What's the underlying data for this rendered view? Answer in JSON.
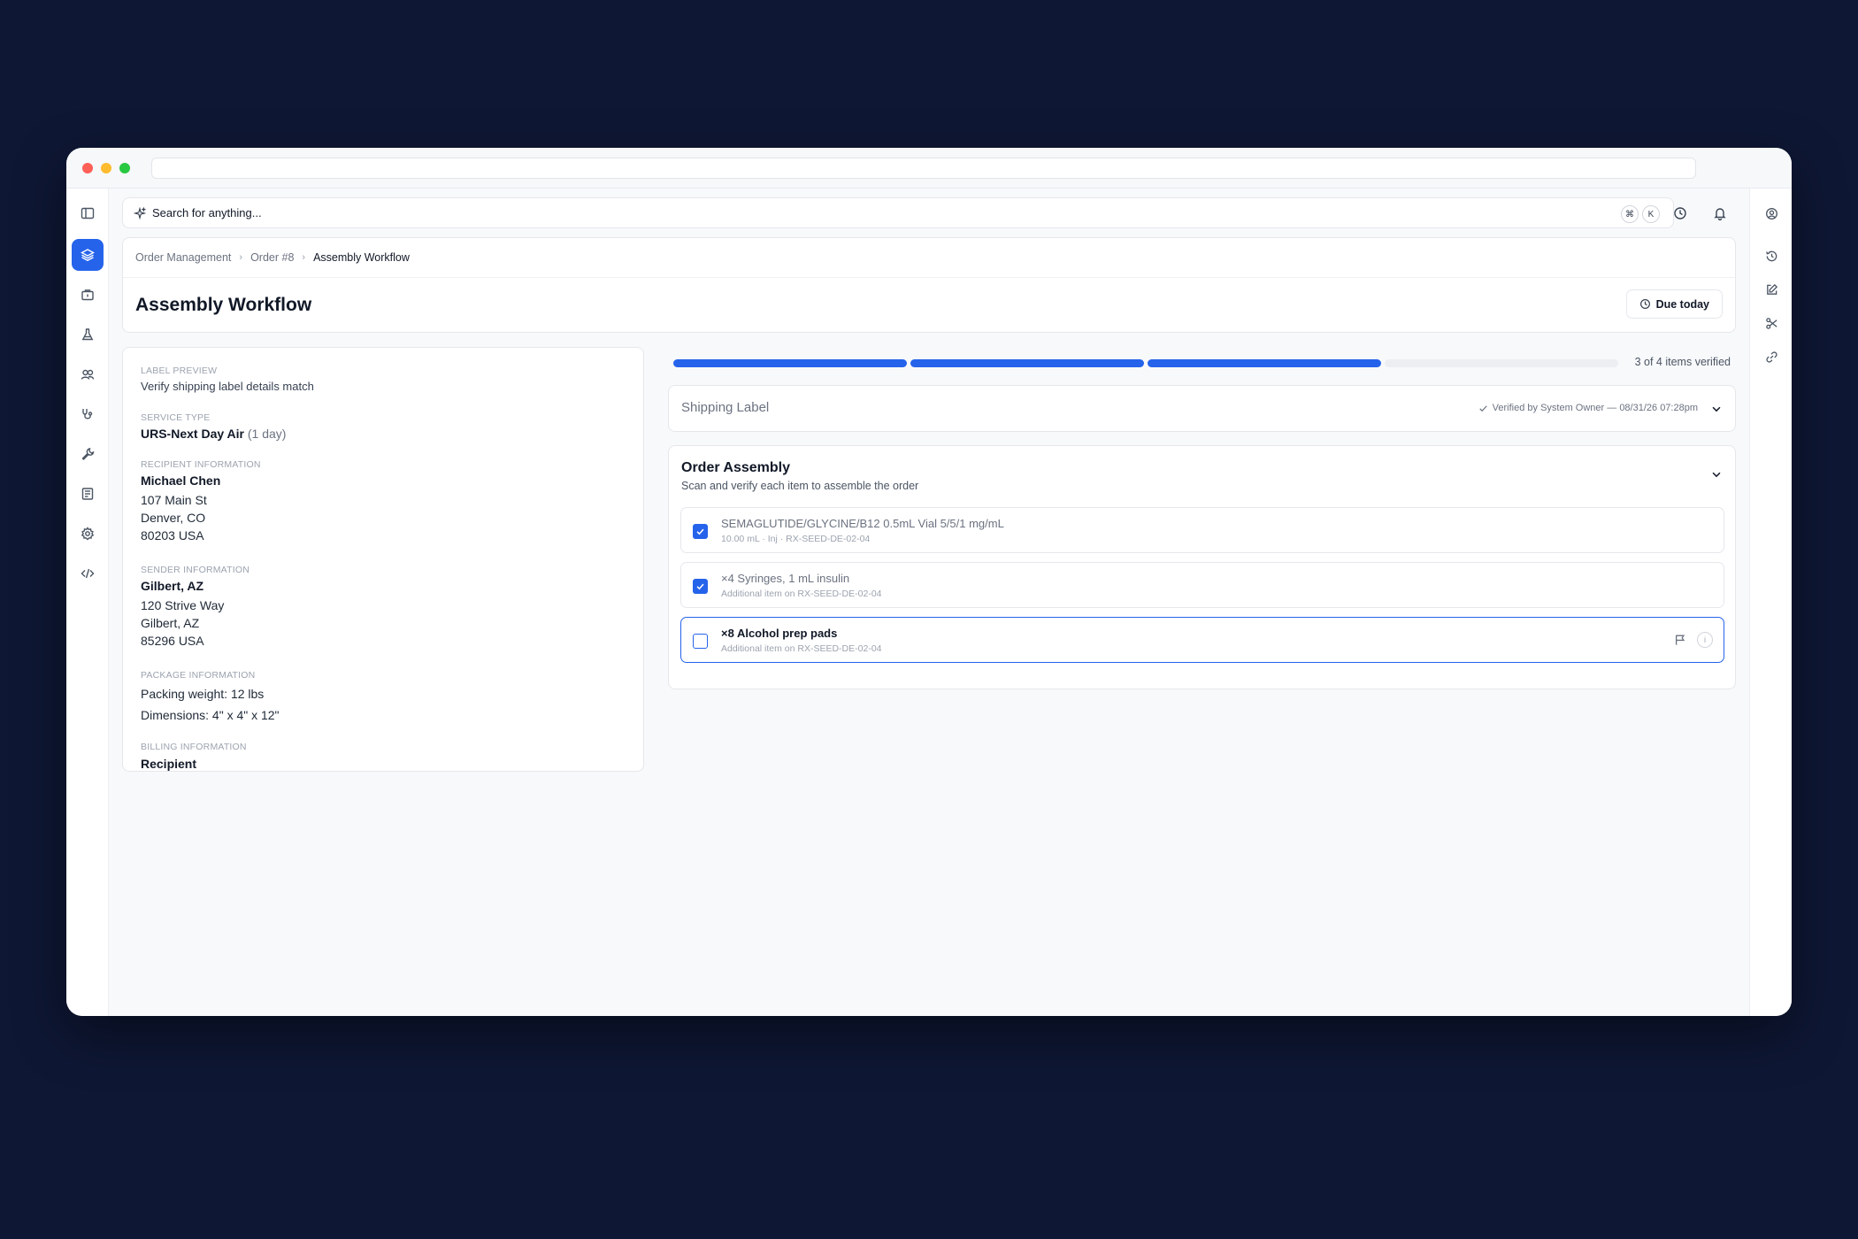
{
  "search": {
    "placeholder": "Search for anything...",
    "shortcut": [
      "⌘",
      "K"
    ]
  },
  "breadcrumb": [
    "Order Management",
    "Order #8",
    "Assembly Workflow"
  ],
  "page": {
    "title": "Assembly Workflow",
    "due_label": "Due today"
  },
  "label_preview": {
    "heading": "LABEL PREVIEW",
    "subheading": "Verify shipping label details match",
    "service_type_label": "SERVICE TYPE",
    "service_type": "URS-Next Day Air",
    "service_duration": "(1 day)",
    "recipient_label": "RECIPIENT INFORMATION",
    "recipient_name": "Michael Chen",
    "recipient_address": [
      "107 Main St",
      "Denver, CO",
      "80203 USA"
    ],
    "sender_label": "SENDER INFORMATION",
    "sender_name": "Gilbert, AZ",
    "sender_address": [
      "120 Strive Way",
      "Gilbert, AZ",
      "85296 USA"
    ],
    "package_label": "PACKAGE INFORMATION",
    "package_weight": "Packing weight: 12 lbs",
    "package_dimensions": "Dimensions: 4\" x 4\" x 12\"",
    "billing_label": "BILLING INFORMATION",
    "billing_value": "Recipient"
  },
  "progress": {
    "verified": 3,
    "total": 4,
    "text": "3 of 4 items verified"
  },
  "shipping_label": {
    "title": "Shipping Label",
    "verified_text": "Verified by System Owner — 08/31/26 07:28pm"
  },
  "order_assembly": {
    "title": "Order Assembly",
    "subtitle": "Scan and verify each item to assemble the order",
    "items": [
      {
        "name": "SEMAGLUTIDE/GLYCINE/B12 0.5mL Vial 5/5/1 mg/mL",
        "sub": "10.00 mL · Inj · RX-SEED-DE-02-04",
        "checked": true
      },
      {
        "name": "×4 Syringes, 1 mL insulin",
        "sub": "Additional item on RX-SEED-DE-02-04",
        "checked": true
      },
      {
        "name": "×8 Alcohol prep pads",
        "sub": "Additional item on RX-SEED-DE-02-04",
        "checked": false
      }
    ]
  },
  "colors": {
    "accent": "#2563eb",
    "background": "#0e1734"
  }
}
